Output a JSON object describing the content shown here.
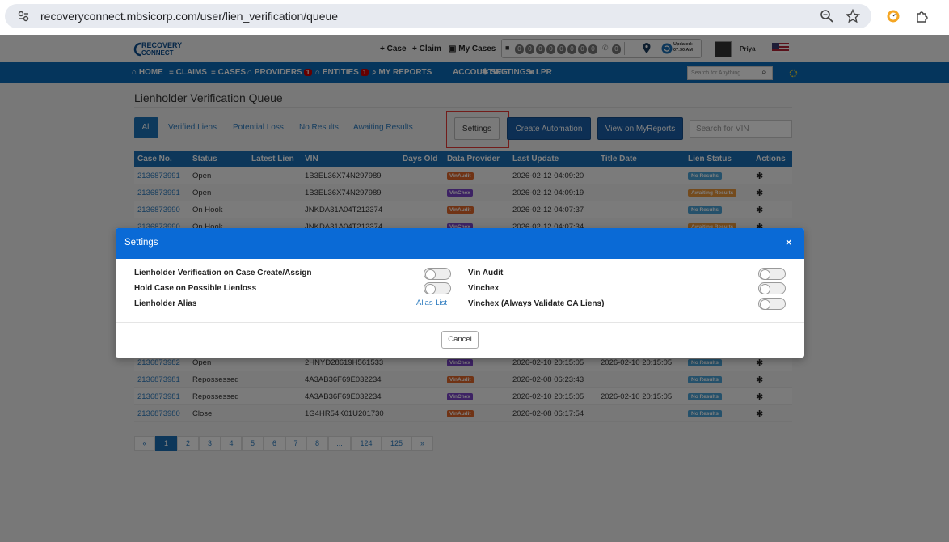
{
  "browser": {
    "url": "recoveryconnect.mbsicorp.com/user/lien_verification/queue"
  },
  "header": {
    "logo_line1": "RECOVERY",
    "logo_line2": "CONNECT",
    "links": [
      "Case",
      "Claim",
      "My Cases"
    ],
    "counter_digits": [
      "0",
      "0",
      "0",
      "0",
      "0",
      "0",
      "0",
      "0"
    ],
    "counter_small": "0",
    "updated_label": "Updated:",
    "updated_time": "07:30 AM",
    "user_name": "Priya"
  },
  "nav": {
    "items": [
      {
        "label": "HOME"
      },
      {
        "label": "CLAIMS"
      },
      {
        "label": "CASES"
      },
      {
        "label": "PROVIDERS",
        "badge": "1"
      },
      {
        "label": "ENTITIES",
        "badge": "1"
      },
      {
        "label": "MY REPORTS"
      },
      {
        "label": "ACCOUNTING"
      },
      {
        "label": "SETTINGS"
      },
      {
        "label": "LPR"
      }
    ],
    "search_placeholder": "Search for Anything"
  },
  "page": {
    "title": "Lienholder Verification Queue",
    "filters": [
      "All",
      "Verified Liens",
      "Potential Loss",
      "No Results",
      "Awaiting Results"
    ],
    "buttons": {
      "settings": "Settings",
      "create_automation": "Create Automation",
      "view_reports": "View on MyReports"
    },
    "vin_placeholder": "Search for VIN"
  },
  "table": {
    "headers": [
      "Case No.",
      "Status",
      "Latest Lien",
      "VIN",
      "Days Old",
      "Data Provider",
      "Last Update",
      "Title Date",
      "Lien Status",
      "Actions"
    ],
    "rows": [
      {
        "case": "2136873991",
        "status": "Open",
        "vin": "1B3EL36X74N297989",
        "provider": "VinAudit",
        "update": "2026-02-12 04:09:20",
        "title_date": "",
        "lien": "No Results"
      },
      {
        "case": "2136873991",
        "status": "Open",
        "vin": "1B3EL36X74N297989",
        "provider": "VinChex",
        "update": "2026-02-12 04:09:19",
        "title_date": "",
        "lien": "Awaiting Results"
      },
      {
        "case": "2136873990",
        "status": "On Hook",
        "vin": "JNKDA31A04T212374",
        "provider": "VinAudit",
        "update": "2026-02-12 04:07:37",
        "title_date": "",
        "lien": "No Results"
      },
      {
        "case": "2136873990",
        "status": "On Hook",
        "vin": "JNKDA31A04T212374",
        "provider": "VinChex",
        "update": "2026-02-12 04:07:34",
        "title_date": "",
        "lien": "Awaiting Results"
      },
      {
        "case": "2136873982",
        "status": "Open",
        "vin": "2HNYD28619H561533",
        "provider": "VinChex",
        "update": "2026-02-10 20:15:05",
        "title_date": "2026-02-10 20:15:05",
        "lien": "No Results"
      },
      {
        "case": "2136873981",
        "status": "Repossessed",
        "vin": "4A3AB36F69E032234",
        "provider": "VinAudit",
        "update": "2026-02-08 06:23:43",
        "title_date": "",
        "lien": "No Results"
      },
      {
        "case": "2136873981",
        "status": "Repossessed",
        "vin": "4A3AB36F69E032234",
        "provider": "VinChex",
        "update": "2026-02-10 20:15:05",
        "title_date": "2026-02-10 20:15:05",
        "lien": "No Results"
      },
      {
        "case": "2136873980",
        "status": "Close",
        "vin": "1G4HR54K01U201730",
        "provider": "VinAudit",
        "update": "2026-02-08 06:17:54",
        "title_date": "",
        "lien": "No Results"
      }
    ]
  },
  "pagination": [
    "«",
    "1",
    "2",
    "3",
    "4",
    "5",
    "6",
    "7",
    "8",
    "...",
    "124",
    "125",
    "»"
  ],
  "modal": {
    "title": "Settings",
    "close": "×",
    "left_settings": [
      "Lienholder Verification on Case Create/Assign",
      "Hold Case on Possible Lienloss",
      "Lienholder Alias"
    ],
    "alias_link": "Alias List",
    "right_settings": [
      "Vin Audit",
      "Vinchex",
      "Vinchex (Always Validate CA Liens)"
    ],
    "cancel": "Cancel"
  },
  "colors": {
    "nav_blue": "#0a6ab8",
    "modal_header": "#0a6ad6",
    "vinaudit_tag": "#e0662a",
    "vinchex_tag": "#7b45c9",
    "no_results_tag": "#4aa3d6",
    "awaiting_tag": "#e8963a"
  }
}
